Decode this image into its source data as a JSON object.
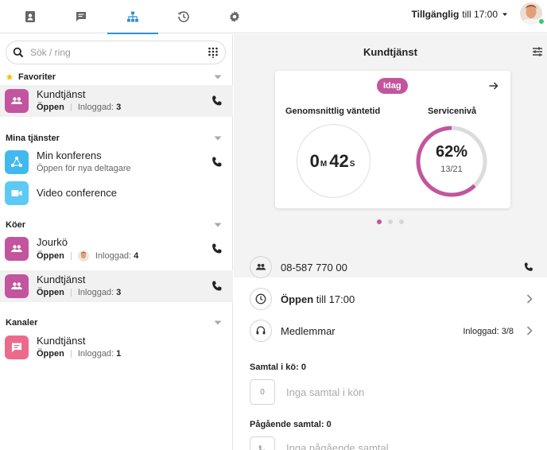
{
  "nav": {
    "tabs": [
      {
        "name": "contacts",
        "icon": "contact-book-icon"
      },
      {
        "name": "messages",
        "icon": "chat-icon"
      },
      {
        "name": "organization",
        "icon": "org-chart-icon",
        "active": true
      },
      {
        "name": "history",
        "icon": "history-icon"
      },
      {
        "name": "settings",
        "icon": "gear-icon"
      }
    ],
    "status_label": "Tillgänglig",
    "status_until": "till 17:00"
  },
  "search": {
    "placeholder": "Sök / ring"
  },
  "sections": {
    "favorites": {
      "title": "Favoriter",
      "items": [
        {
          "title": "Kundtjänst",
          "state": "Öppen",
          "logged_label": "Inloggad:",
          "logged_count": "3"
        }
      ]
    },
    "services": {
      "title": "Mina tjänster",
      "items": [
        {
          "title": "Min konferens",
          "subtitle": "Öppen för nya deltagare"
        },
        {
          "title": "Video conference"
        }
      ]
    },
    "queues": {
      "title": "Köer",
      "items": [
        {
          "title": "Jourkö",
          "state": "Öppen",
          "logged_label": "Inloggad:",
          "logged_count": "4"
        },
        {
          "title": "Kundtjänst",
          "state": "Öppen",
          "logged_label": "Inloggad:",
          "logged_count": "3"
        }
      ]
    },
    "channels": {
      "title": "Kanaler",
      "items": [
        {
          "title": "Kundtjänst",
          "state": "Öppen",
          "logged_label": "Inloggad:",
          "logged_count": "1"
        }
      ]
    }
  },
  "detail": {
    "title": "Kundtjänst",
    "stats": {
      "period": "Idag",
      "wait_label": "Genomsnittlig väntetid",
      "wait_minutes": "0",
      "wait_minutes_unit": "M",
      "wait_seconds": "42",
      "wait_seconds_unit": "S",
      "service_label": "Servicenivå",
      "service_percent": "62%",
      "service_fraction": "13/21",
      "service_level": 0.62,
      "pages": 3,
      "current_page": 1
    },
    "phone_number": "08-587 770 00",
    "open_state": "Öppen",
    "open_until": "till 17:00",
    "members_label": "Medlemmar",
    "members_logged": "Inloggad: 3/8",
    "queue_calls_label": "Samtal i kö:",
    "queue_calls_count": "0",
    "queue_calls_box": "0",
    "queue_calls_empty": "Inga samtal i kön",
    "ongoing_label": "Pågående samtal:",
    "ongoing_count": "0",
    "ongoing_empty": "Inga pågående samtal"
  },
  "colors": {
    "accent": "#2f8fd8",
    "queue_purple": "#c2559d",
    "service_blue": "#42b9ee",
    "video_blue": "#5ccaf5",
    "channel_pink": "#ec6b8c",
    "online": "#2ecc71",
    "gauge_track": "#dcdcdc"
  }
}
